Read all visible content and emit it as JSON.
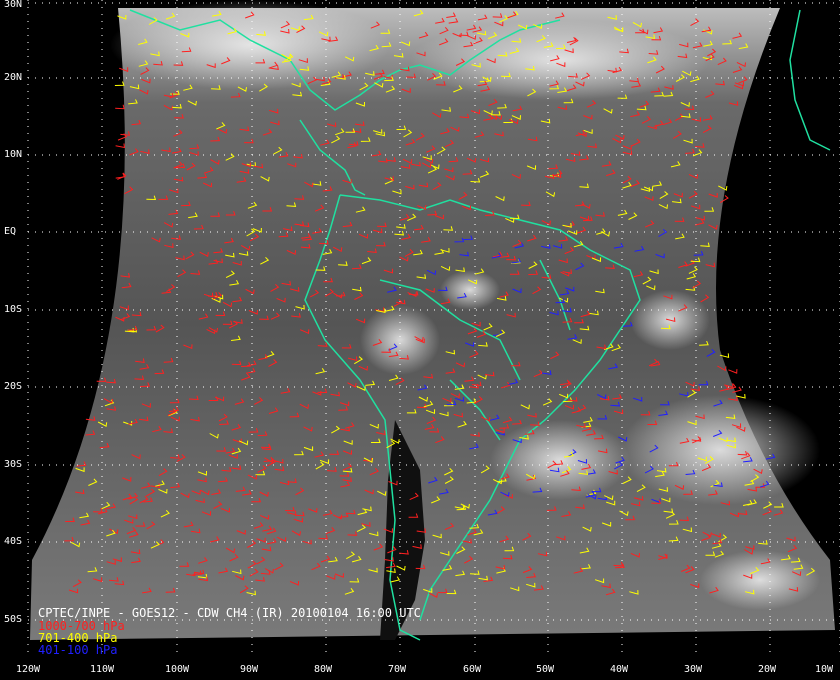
{
  "map": {
    "title": "CPTEC/INPE - GOES12 - CDW CH4 (IR) 20100104 16:00 UTC",
    "lat_labels": [
      "30N",
      "20N",
      "10N",
      "EQ",
      "10S",
      "20S",
      "30S",
      "40S",
      "50S"
    ],
    "lon_labels": [
      "120W",
      "110W",
      "100W",
      "90W",
      "80W",
      "70W",
      "60W",
      "50W",
      "40W",
      "30W",
      "20W",
      "10W"
    ],
    "legend": [
      {
        "label": "1000-700 hPa",
        "color": "#ff2020"
      },
      {
        "label": "701-400 hPa",
        "color": "#ffff00"
      },
      {
        "label": "401-100 hPa",
        "color": "#2020ff"
      }
    ],
    "coastline_color": "#20e0a0",
    "grid_color": "#ffffff"
  }
}
